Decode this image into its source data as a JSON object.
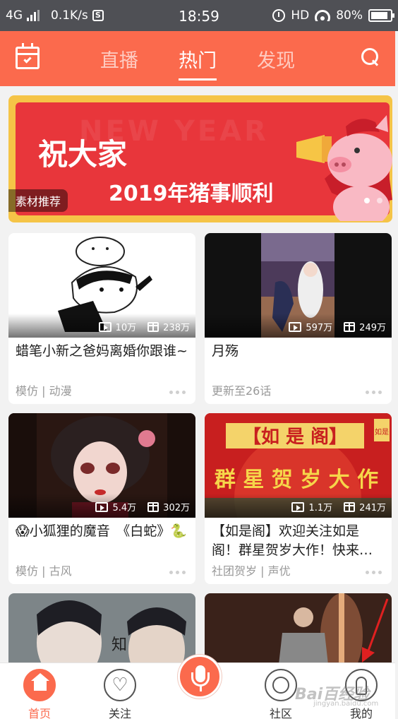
{
  "status_bar": {
    "network": "4G",
    "speed": "0.1K/s",
    "s_badge": "S",
    "time": "18:59",
    "hd": "HD",
    "battery": "80%"
  },
  "header": {
    "tabs": [
      {
        "label": "直播",
        "active": false
      },
      {
        "label": "热门",
        "active": true
      },
      {
        "label": "发现",
        "active": false
      }
    ]
  },
  "banner": {
    "ghost_text": "NEW YEAR",
    "headline": "祝大家",
    "subline": "2019年猪事顺利",
    "tag": "素材推荐",
    "page_index": 1,
    "page_count": 2
  },
  "cards": [
    {
      "views": "10万",
      "gifts": "238万",
      "title": "蜡笔小新之爸妈离婚你跟谁~",
      "meta": "模仿 | 动漫"
    },
    {
      "views": "597万",
      "gifts": "249万",
      "title": "月殇",
      "meta": "更新至26话"
    },
    {
      "views": "5.4万",
      "gifts": "302万",
      "title": "😱小狐狸的魔音　《白蛇》🐍",
      "meta": "模仿 | 古风"
    },
    {
      "views": "1.1万",
      "gifts": "241万",
      "title": "【如是阁】欢迎关注如是阁！群星贺岁大作！快来…",
      "meta": "社团贺岁 | 声优"
    },
    {
      "views": "",
      "gifts": "",
      "title": "",
      "meta": ""
    },
    {
      "views": "",
      "gifts": "",
      "title": "",
      "meta": ""
    }
  ],
  "thumb_text": {
    "c4_top": "【如 是 阁】",
    "c4_main": "群 星 贺 岁 大 作",
    "c4_seal": "如是",
    "c5_text": "知"
  },
  "bottom_nav": {
    "items": [
      {
        "label": "首页",
        "icon": "home-icon",
        "active": true
      },
      {
        "label": "关注",
        "icon": "heart-icon",
        "active": false
      },
      {
        "label": "",
        "icon": "mic-icon",
        "active": false
      },
      {
        "label": "社区",
        "icon": "ring-icon",
        "active": false
      },
      {
        "label": "我的",
        "icon": "person-icon",
        "active": false
      }
    ]
  },
  "watermark": {
    "main": "Bai百经验",
    "sub": "jingyan.baidu.com"
  },
  "colors": {
    "accent": "#fb6a4d",
    "banner_red": "#e8363b",
    "banner_gold": "#f5c447"
  }
}
